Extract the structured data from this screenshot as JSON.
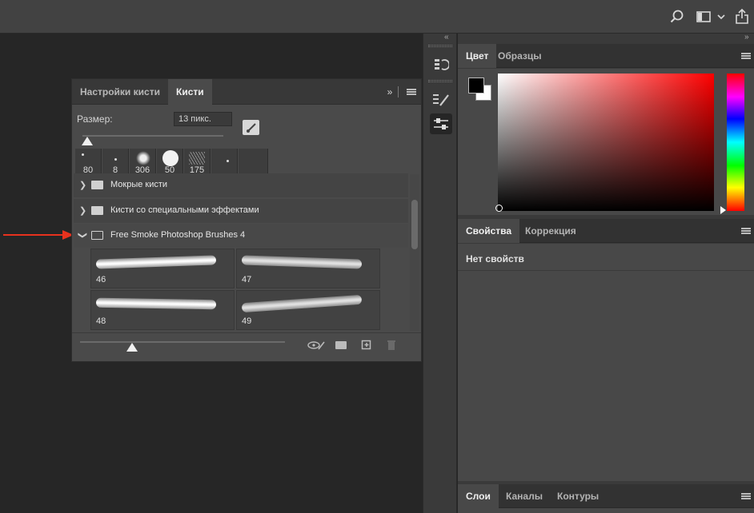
{
  "topbar": {
    "search_icon": "search-icon",
    "workspace_icon": "workspace-icon",
    "share_icon": "share-icon"
  },
  "brushes_panel": {
    "tabs": [
      {
        "label": "Настройки кисти",
        "active": false
      },
      {
        "label": "Кисти",
        "active": true
      }
    ],
    "size_label": "Размер:",
    "size_value": "13 пикс.",
    "presets": [
      {
        "value": "80"
      },
      {
        "value": "8"
      },
      {
        "value": "306"
      },
      {
        "value": "50"
      },
      {
        "value": "175"
      },
      {
        "value": ""
      }
    ],
    "groups": [
      {
        "label": "Мокрые кисти",
        "expanded": false
      },
      {
        "label": "Кисти со специальными эффектами",
        "expanded": false
      },
      {
        "label": "Free Smoke Photoshop Brushes 4",
        "expanded": true
      }
    ],
    "brushes": [
      {
        "number": "46"
      },
      {
        "number": "47"
      },
      {
        "number": "48"
      },
      {
        "number": "49"
      }
    ]
  },
  "color_panel": {
    "tabs": [
      {
        "label": "Цвет",
        "active": true
      },
      {
        "label": "Образцы",
        "active": false
      }
    ],
    "foreground": "#000000",
    "background": "#ffffff",
    "hue": "#ff0000"
  },
  "properties_panel": {
    "tabs": [
      {
        "label": "Свойства",
        "active": true
      },
      {
        "label": "Коррекция",
        "active": false
      }
    ],
    "empty_text": "Нет свойств"
  },
  "layers_panel": {
    "tabs": [
      {
        "label": "Слои",
        "active": true
      },
      {
        "label": "Каналы",
        "active": false
      },
      {
        "label": "Контуры",
        "active": false
      }
    ]
  },
  "colors": {
    "annotation_arrow": "#e8321e",
    "accent": "#ffffff"
  }
}
